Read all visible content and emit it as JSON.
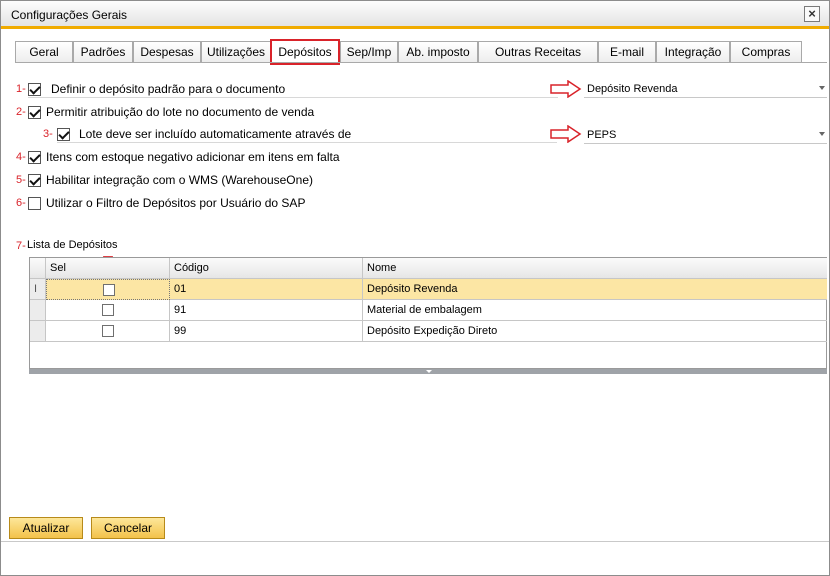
{
  "window": {
    "title": "Configurações Gerais",
    "close_symbol": "×"
  },
  "tabs": [
    {
      "label": "Geral"
    },
    {
      "label": "Padrões"
    },
    {
      "label": "Despesas"
    },
    {
      "label": "Utilizações"
    },
    {
      "label": "Depósitos",
      "active": true
    },
    {
      "label": "Sep/Imp"
    },
    {
      "label": "Ab. imposto"
    },
    {
      "label": "Outras Receitas"
    },
    {
      "label": "E-mail"
    },
    {
      "label": "Integração"
    },
    {
      "label": "Compras"
    }
  ],
  "options": {
    "o1": {
      "num": "1-",
      "label": "Definir o depósito padrão para o documento",
      "checked": true,
      "select_value": "Depósito Revenda"
    },
    "o2": {
      "num": "2-",
      "label": "Permitir atribuição do lote no documento de venda",
      "checked": true
    },
    "o3": {
      "num": "3-",
      "label": "Lote deve ser incluído automaticamente através de",
      "checked": true,
      "select_value": "PEPS"
    },
    "o4": {
      "num": "4-",
      "label": "Itens com estoque negativo adicionar em itens em falta",
      "checked": true
    },
    "o5": {
      "num": "5-",
      "label": "Habilitar integração com o WMS (WarehouseOne)",
      "checked": true
    },
    "o6": {
      "num": "6-",
      "label": "Utilizar o Filtro de Depósitos por Usuário do SAP",
      "checked": false
    }
  },
  "list": {
    "num": "7-",
    "title": "Lista de Depósitos",
    "columns": {
      "sel": "Sel",
      "codigo": "Código",
      "nome": "Nome"
    },
    "rows": [
      {
        "cursor": "I",
        "codigo": "01",
        "nome": "Depósito Revenda",
        "selected": false
      },
      {
        "cursor": "",
        "codigo": "91",
        "nome": "Material de embalagem",
        "selected": false
      },
      {
        "cursor": "",
        "codigo": "99",
        "nome": "Depósito Expedição Direto",
        "selected": false
      }
    ]
  },
  "buttons": {
    "update": "Atualizar",
    "cancel": "Cancelar"
  },
  "colors": {
    "accent": "#f0ab00",
    "annotation": "#d9232a",
    "row_highlight": "#fce6a4"
  },
  "icons": [
    "close-icon",
    "red-arrow-right-icon",
    "red-arrow-down-icon",
    "checkmark-icon",
    "dropdown-caret-icon"
  ]
}
